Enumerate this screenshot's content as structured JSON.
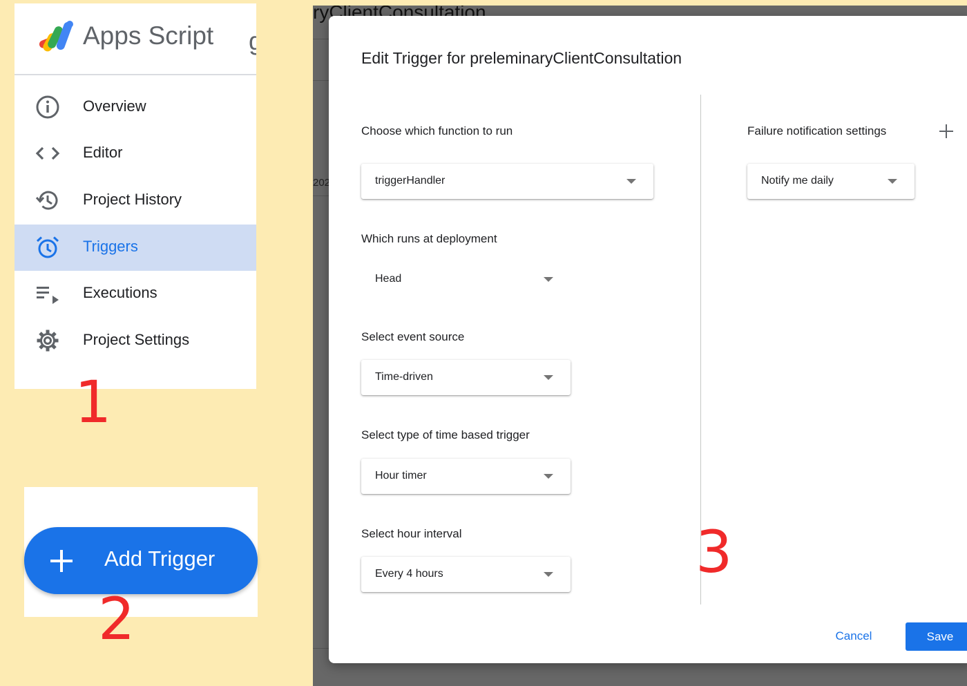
{
  "sidebar": {
    "app_title": "Apps Script",
    "cut_letter": "g",
    "items": [
      {
        "label": "Overview",
        "icon": "info-icon"
      },
      {
        "label": "Editor",
        "icon": "code-brackets-icon"
      },
      {
        "label": "Project History",
        "icon": "history-icon"
      },
      {
        "label": "Triggers",
        "icon": "alarm-clock-icon",
        "active": true
      },
      {
        "label": "Executions",
        "icon": "list-play-icon"
      },
      {
        "label": "Project Settings",
        "icon": "gear-icon"
      }
    ]
  },
  "add_trigger": {
    "label": "Add Trigger",
    "icon": "plus-icon"
  },
  "annotations": {
    "one": "1",
    "two": "2",
    "three": "3"
  },
  "background": {
    "title_fragment": "ryClientConsultation",
    "year_fragment": "202"
  },
  "dialog": {
    "title": "Edit Trigger for preleminaryClientConsultation",
    "function_label": "Choose which function to run",
    "function_value": "triggerHandler",
    "deployment_label": "Which runs at deployment",
    "deployment_value": "Head",
    "event_source_label": "Select event source",
    "event_source_value": "Time-driven",
    "time_type_label": "Select type of time based trigger",
    "time_type_value": "Hour timer",
    "hour_interval_label": "Select hour interval",
    "hour_interval_value": "Every 4 hours",
    "failure_label": "Failure notification settings",
    "failure_value": "Notify me daily",
    "cancel_label": "Cancel",
    "save_label": "Save"
  },
  "colors": {
    "accent": "#1a73e8",
    "active_nav_bg": "#cfdcf3",
    "page_bg": "#fdebb3",
    "annotation": "#f02a2a"
  }
}
